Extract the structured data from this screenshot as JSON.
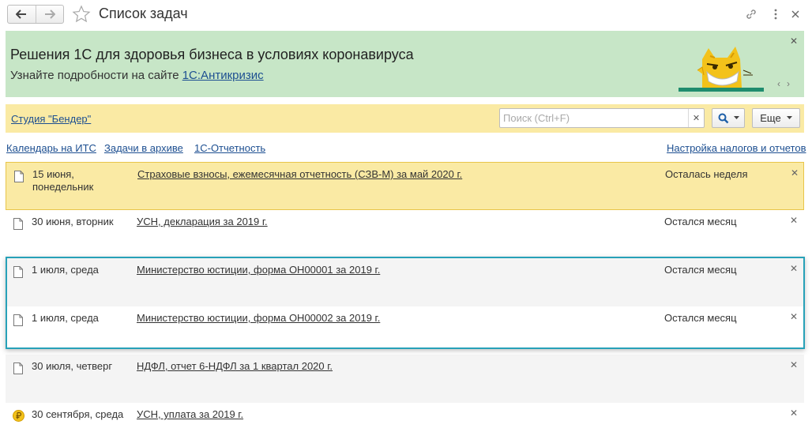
{
  "window": {
    "title": "Список задач"
  },
  "banner": {
    "title": "Решения 1С для здоровья бизнеса в условиях коронавируса",
    "sub_prefix": "Узнайте подробности на сайте",
    "link_label": "1С:Антикризис"
  },
  "filter": {
    "organization_label": "Студия \"Бендер\"",
    "search_placeholder": "Поиск (Ctrl+F)",
    "search_value": "",
    "more_label": "Еще"
  },
  "links": {
    "its_calendar": "Календарь на ИТС",
    "archive": "Задачи в архиве",
    "reporting": "1С-Отчетность",
    "settings": "Настройка налогов и отчетов"
  },
  "tasks": [
    {
      "date": "15 июня, понедельник",
      "title": "Страховые взносы, ежемесячная отчетность (СЗВ-М) за май 2020 г.",
      "remaining": "Осталась неделя",
      "icon": "document-icon"
    },
    {
      "date": "30 июня, вторник",
      "title": "УСН, декларация за 2019 г.",
      "remaining": "Остался месяц",
      "icon": "document-icon"
    },
    {
      "date": "1 июля, среда",
      "title": "Министерство юстиции, форма ОН00001 за 2019 г.",
      "remaining": "Остался месяц",
      "icon": "document-icon"
    },
    {
      "date": "1 июля, среда",
      "title": "Министерство юстиции, форма ОН00002 за 2019 г.",
      "remaining": "Остался месяц",
      "icon": "document-icon"
    },
    {
      "date": "30 июля, четверг",
      "title": "НДФЛ, отчет 6-НДФЛ за 1 квартал 2020 г.",
      "remaining": "",
      "icon": "document-icon"
    },
    {
      "date": "30 сентября, среда",
      "title": "УСН, уплата за 2019 г.",
      "remaining": "",
      "icon": "ruble-coin-icon"
    }
  ],
  "colors": {
    "banner_bg": "#c7e6c7",
    "toolbar_bg": "#faeaa4",
    "link": "#1d4f91",
    "selection_border": "#27a1b8",
    "coin": "#f2c21b"
  }
}
